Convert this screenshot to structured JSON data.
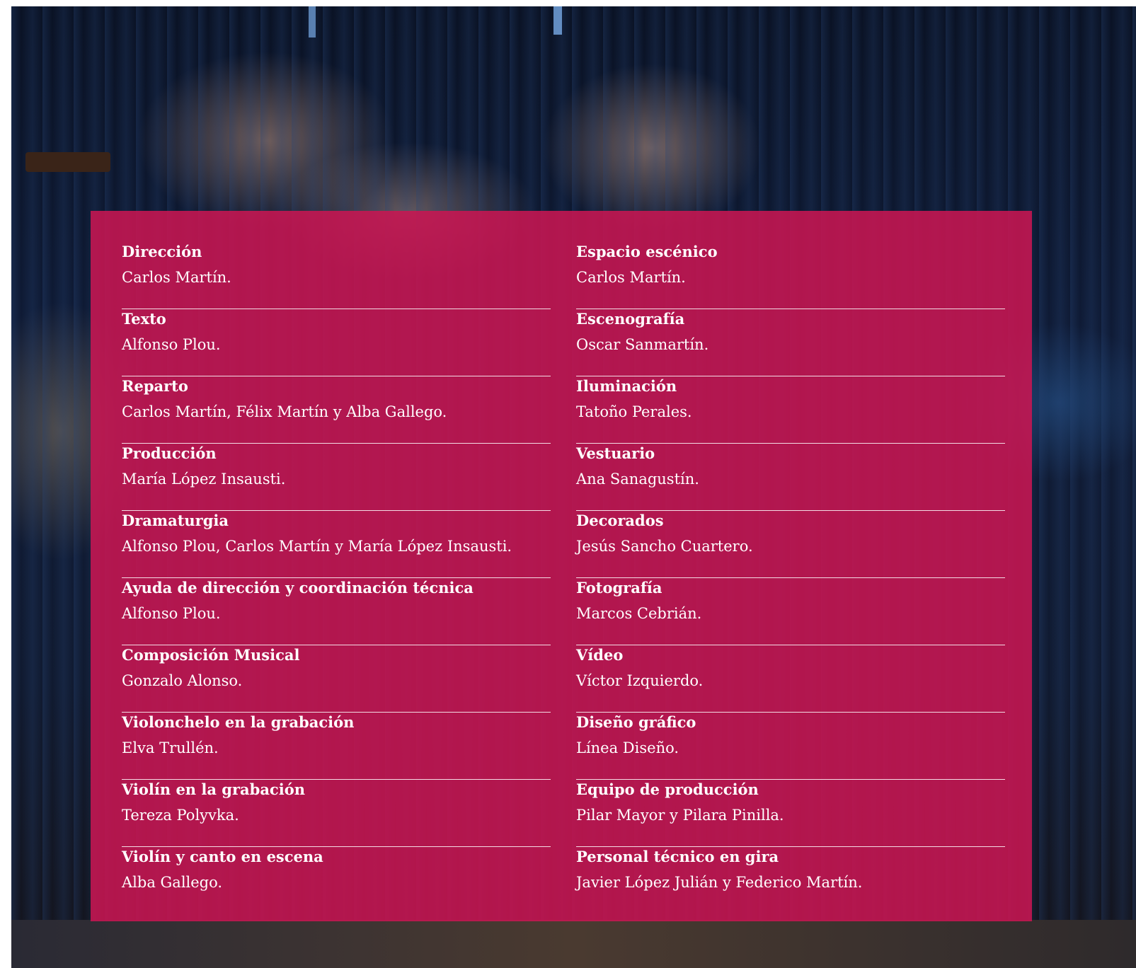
{
  "credits": {
    "left": [
      {
        "role": "Dirección",
        "name": "Carlos Martín."
      },
      {
        "role": "Texto",
        "name": "Alfonso Plou."
      },
      {
        "role": "Reparto",
        "name": "Carlos Martín, Félix Martín y Alba Gallego."
      },
      {
        "role": "Producción",
        "name": "María López Insausti."
      },
      {
        "role": "Dramaturgia",
        "name": "Alfonso Plou, Carlos Martín y María López Insausti."
      },
      {
        "role": "Ayuda de dirección y coordinación técnica",
        "name": "Alfonso Plou."
      },
      {
        "role": "Composición Musical",
        "name": "Gonzalo Alonso."
      },
      {
        "role": "Violonchelo en la grabación",
        "name": "Elva Trullén."
      },
      {
        "role": "Violín en la grabación",
        "name": "Tereza Polyvka."
      },
      {
        "role": "Violín y canto en escena",
        "name": "Alba Gallego."
      }
    ],
    "right": [
      {
        "role": "Espacio escénico",
        "name": "Carlos Martín."
      },
      {
        "role": "Escenografía",
        "name": "Oscar Sanmartín."
      },
      {
        "role": "Iluminación",
        "name": "Tatoño Perales."
      },
      {
        "role": "Vestuario",
        "name": "Ana Sanagustín."
      },
      {
        "role": "Decorados",
        "name": "Jesús Sancho Cuartero."
      },
      {
        "role": "Fotografía",
        "name": "Marcos Cebrián."
      },
      {
        "role": "Vídeo",
        "name": "Víctor Izquierdo."
      },
      {
        "role": "Diseño gráfico",
        "name": "Línea Diseño."
      },
      {
        "role": "Equipo de producción",
        "name": "Pilar Mayor y Pilara Pinilla."
      },
      {
        "role": "Personal técnico en gira",
        "name": "Javier López Julián y Federico Martín."
      }
    ]
  },
  "colors": {
    "panel": "#c81652",
    "text": "#ffffff"
  }
}
